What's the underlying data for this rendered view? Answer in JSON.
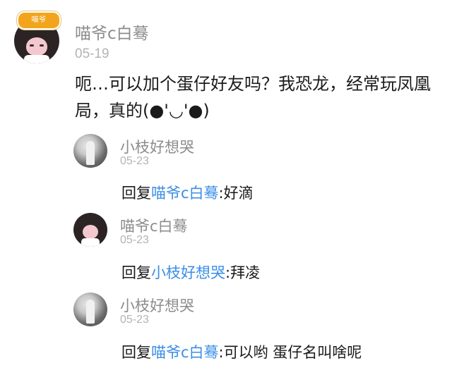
{
  "main_comment": {
    "badge": "喵爷",
    "author": "喵爷c白蓦",
    "date": "05-19",
    "content": "呃…可以加个蛋仔好友吗？我恐龙，经常玩凤凰局，真的(●'◡'●)"
  },
  "replies": [
    {
      "author": "小枝好想哭",
      "date": "05-23",
      "prefix": "回复",
      "mention": "喵爷c白蓦",
      "text": ":好滴"
    },
    {
      "author": "喵爷c白蓦",
      "date": "05-23",
      "prefix": "回复",
      "mention": "小枝好想哭",
      "text": ":拜凌"
    },
    {
      "author": "小枝好想哭",
      "date": "05-23",
      "prefix": "回复",
      "mention": "喵爷c白蓦",
      "text": ":可以哟 蛋仔名叫啥呢"
    }
  ],
  "colors": {
    "mention": "#3a8ee6",
    "name": "#8c8c8c",
    "date": "#b3b3b3",
    "text": "#1a1a1a",
    "badge": "#f2a51c"
  }
}
